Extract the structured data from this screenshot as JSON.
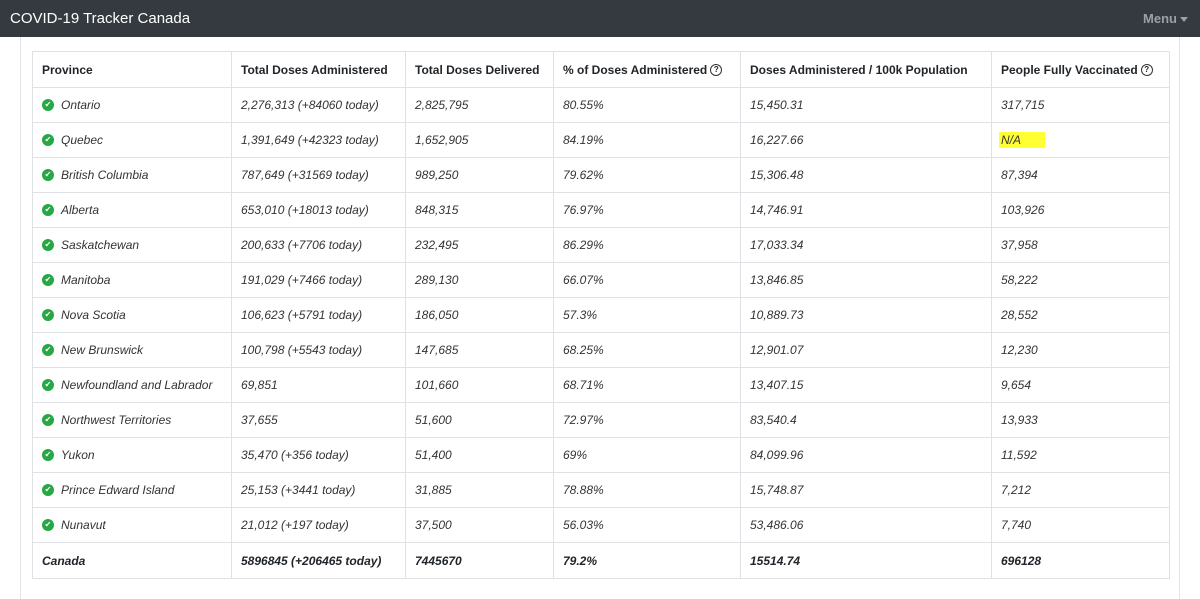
{
  "nav": {
    "brand": "COVID-19 Tracker Canada",
    "menu_label": "Menu"
  },
  "table": {
    "columns": [
      {
        "label": "Province",
        "help": false
      },
      {
        "label": "Total Doses Administered",
        "help": false
      },
      {
        "label": "Total Doses Delivered",
        "help": false
      },
      {
        "label": "% of Doses Administered",
        "help": true
      },
      {
        "label": "Doses Administered / 100k Population",
        "help": false
      },
      {
        "label": "People Fully Vaccinated",
        "help": true
      }
    ],
    "rows": [
      [
        "Ontario",
        "2,276,313 (+84060 today)",
        "2,825,795",
        "80.55%",
        "15,450.31",
        "317,715"
      ],
      [
        "Quebec",
        "1,391,649 (+42323 today)",
        "1,652,905",
        "84.19%",
        "16,227.66",
        "N/A"
      ],
      [
        "British Columbia",
        "787,649 (+31569 today)",
        "989,250",
        "79.62%",
        "15,306.48",
        "87,394"
      ],
      [
        "Alberta",
        "653,010 (+18013 today)",
        "848,315",
        "76.97%",
        "14,746.91",
        "103,926"
      ],
      [
        "Saskatchewan",
        "200,633 (+7706 today)",
        "232,495",
        "86.29%",
        "17,033.34",
        "37,958"
      ],
      [
        "Manitoba",
        "191,029 (+7466 today)",
        "289,130",
        "66.07%",
        "13,846.85",
        "58,222"
      ],
      [
        "Nova Scotia",
        "106,623 (+5791 today)",
        "186,050",
        "57.3%",
        "10,889.73",
        "28,552"
      ],
      [
        "New Brunswick",
        "100,798 (+5543 today)",
        "147,685",
        "68.25%",
        "12,901.07",
        "12,230"
      ],
      [
        "Newfoundland and Labrador",
        "69,851",
        "101,660",
        "68.71%",
        "13,407.15",
        "9,654"
      ],
      [
        "Northwest Territories",
        "37,655",
        "51,600",
        "72.97%",
        "83,540.4",
        "13,933"
      ],
      [
        "Yukon",
        "35,470 (+356 today)",
        "51,400",
        "69%",
        "84,099.96",
        "11,592"
      ],
      [
        "Prince Edward Island",
        "25,153 (+3441 today)",
        "31,885",
        "78.88%",
        "15,748.87",
        "7,212"
      ],
      [
        "Nunavut",
        "21,012 (+197 today)",
        "37,500",
        "56.03%",
        "53,486.06",
        "7,740"
      ]
    ],
    "total": [
      "Canada",
      "5896845 (+206465 today)",
      "7445670",
      "79.2%",
      "15514.74",
      "696128"
    ]
  },
  "icons": {
    "row_status": "check-circle-icon",
    "header_help": "question-circle-icon"
  },
  "colors": {
    "navbar": "#343a40",
    "check": "#28a745",
    "highlight": "#ffff33"
  }
}
